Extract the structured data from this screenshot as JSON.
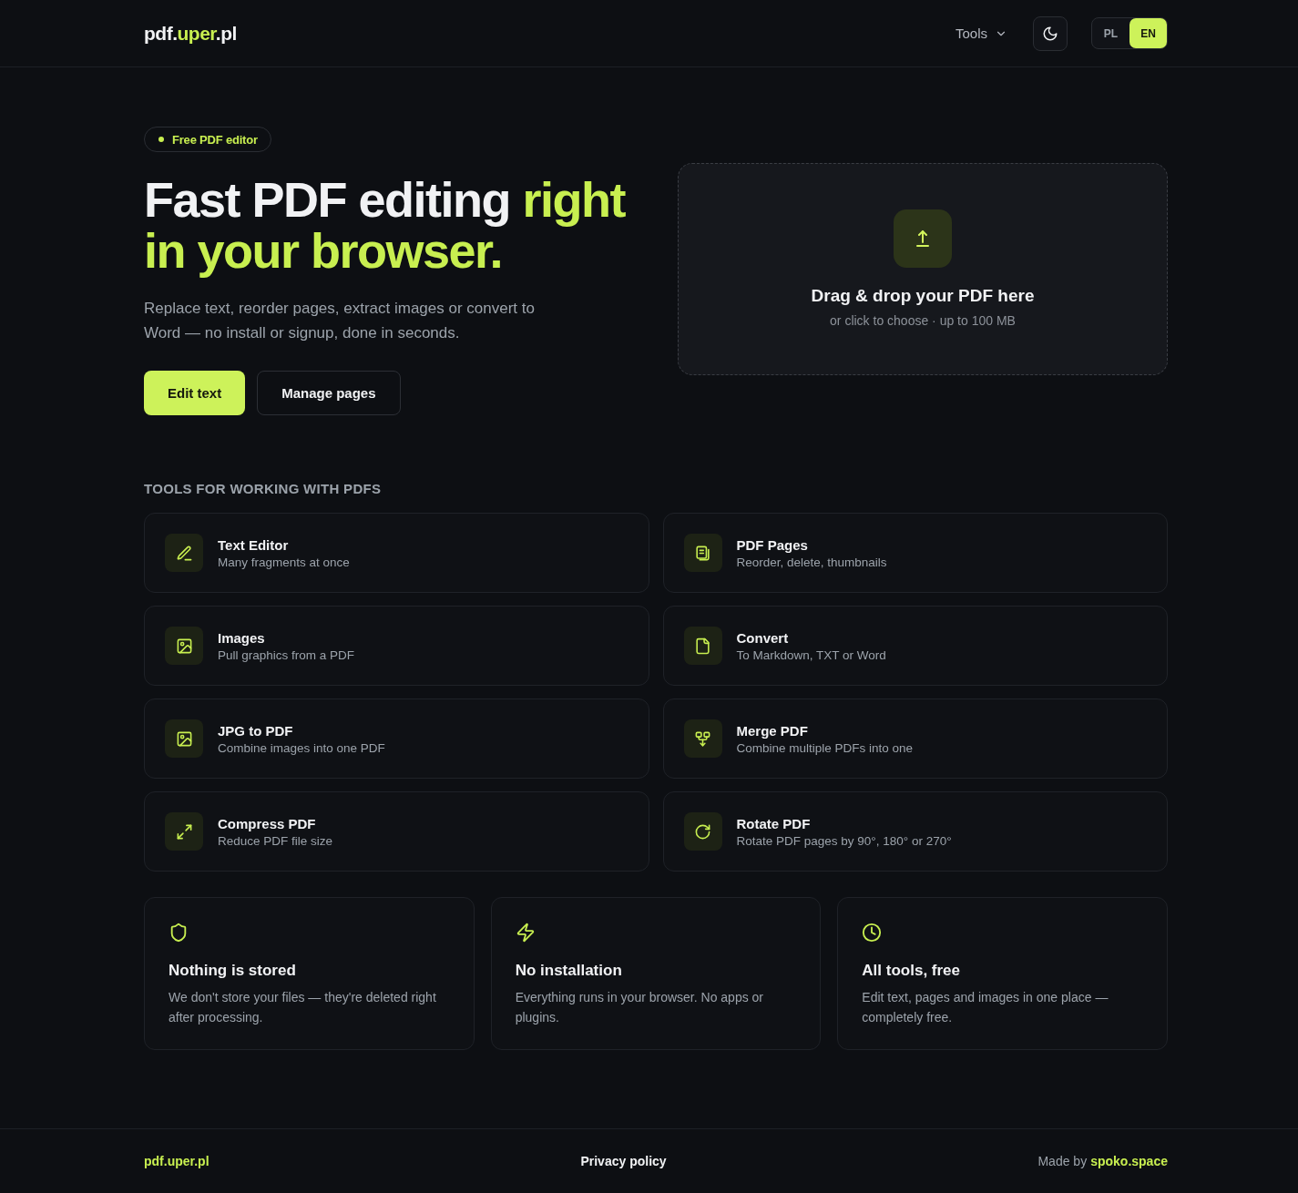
{
  "header": {
    "logo": {
      "prefix": "pdf.",
      "highlight": "uper",
      "suffix": ".pl"
    },
    "nav": {
      "label": "Tools"
    },
    "languages": [
      {
        "label": "PL",
        "selected": false
      },
      {
        "label": "EN",
        "selected": true
      }
    ]
  },
  "hero": {
    "badge": "Free PDF editor",
    "headline": {
      "text": "Fast PDF editing",
      "highlight": "right in your browser."
    },
    "description": "Replace text, reorder pages, extract images or convert to Word — no install or signup, done in seconds.",
    "buttons": [
      {
        "label": "Edit text",
        "kind": "primary"
      },
      {
        "label": "Manage pages",
        "kind": "secondary"
      }
    ]
  },
  "upload": {
    "title": "Drag & drop your PDF here",
    "subtitle": "or click to choose · up to 100 MB"
  },
  "tools": {
    "title": "TOOLS FOR WORKING WITH PDFS",
    "items": [
      {
        "title": "Text Editor",
        "description": "Many fragments at once"
      },
      {
        "title": "PDF Pages",
        "description": "Reorder, delete, thumbnails"
      },
      {
        "title": "Images",
        "description": "Pull graphics from a PDF"
      },
      {
        "title": "Convert",
        "description": "To Markdown, TXT or Word"
      },
      {
        "title": "JPG to PDF",
        "description": "Combine images into one PDF"
      },
      {
        "title": "Merge PDF",
        "description": "Combine multiple PDFs into one"
      },
      {
        "title": "Compress PDF",
        "description": "Reduce PDF file size"
      },
      {
        "title": "Rotate PDF",
        "description": "Rotate PDF pages by 90°, 180° or 270°"
      }
    ]
  },
  "features": [
    {
      "title": "Nothing is stored",
      "description": "We don't store your files — they're deleted right after processing."
    },
    {
      "title": "No installation",
      "description": "Everything runs in your browser. No apps or plugins."
    },
    {
      "title": "All tools, free",
      "description": "Edit text, pages and images in one place — completely free."
    }
  ],
  "footer": {
    "logo": "pdf.uper.pl",
    "links": [
      {
        "label": "Privacy policy"
      }
    ],
    "credit_label": "Made by",
    "credit_link": "spoko.space"
  }
}
